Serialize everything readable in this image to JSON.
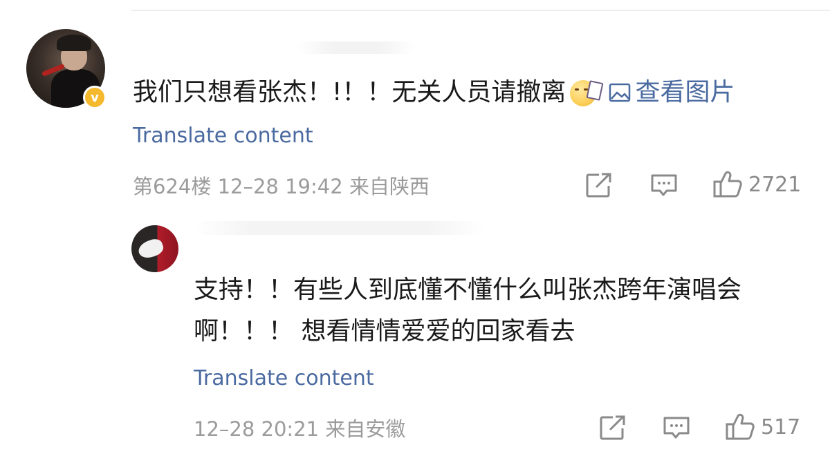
{
  "main_comment": {
    "text": "我们只想看张杰！!！！无关人员请撤离",
    "view_image_label": "查看图片",
    "translate_label": "Translate content",
    "meta": "第624楼 12–28 19:42 来自陕西",
    "like_count": "2721",
    "icons": {
      "share": "share-icon",
      "comment": "comment-icon",
      "like": "like-icon",
      "verified": "verified-badge-icon",
      "image": "image-icon",
      "emoji": "emoji-icon"
    }
  },
  "reply": {
    "line1": "支持！！有些人到底懂不懂什么叫张杰跨年演唱会",
    "line2": "啊！！！ 想看情情爱爱的回家看去",
    "translate_label": "Translate content",
    "meta": "12–28 20:21 来自安徽",
    "like_count": "517"
  },
  "colors": {
    "link": "#4a6aa0",
    "meta": "#9b9b9b",
    "text": "#1a1a1a",
    "verified": "#f5b92e"
  }
}
